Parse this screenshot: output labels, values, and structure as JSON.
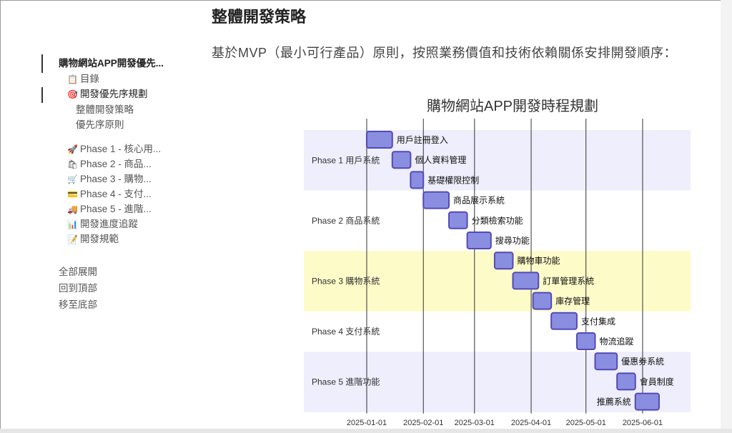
{
  "page": {
    "title": "整體開發策略",
    "intro": "基於MVP（最小可行產品）原則，按照業務價值和技術依賴關係安排開發順序："
  },
  "toc": {
    "title": "購物網站APP開發優先...",
    "items": [
      {
        "icon": "📋",
        "icon_name": "clipboard-icon",
        "label": "目錄"
      },
      {
        "icon": "🎯",
        "icon_name": "target-icon",
        "label": "開發優先序規劃"
      },
      {
        "icon": "🚀",
        "icon_name": "rocket-icon",
        "label": "Phase 1 - 核心用..."
      },
      {
        "icon": "🛍",
        "icon_name": "shopping-bags-icon",
        "label": "Phase 2 - 商品..."
      },
      {
        "icon": "🛒",
        "icon_name": "shopping-cart-icon",
        "label": "Phase 3 - 購物..."
      },
      {
        "icon": "💳",
        "icon_name": "credit-card-icon",
        "label": "Phase 4 - 支付..."
      },
      {
        "icon": "🚚",
        "icon_name": "delivery-truck-icon",
        "label": "Phase 5 - 進階..."
      },
      {
        "icon": "📊",
        "icon_name": "bar-chart-icon",
        "label": "開發進度追蹤"
      },
      {
        "icon": "📝",
        "icon_name": "memo-icon",
        "label": "開發規範"
      }
    ],
    "subitems": [
      "整體開發策略",
      "優先序原則"
    ],
    "controls": [
      "全部展開",
      "回到頂部",
      "移至底部"
    ]
  },
  "chart_data": {
    "type": "gantt",
    "title": "購物網站APP開發時程規劃",
    "x_ticks": [
      "2025-01-01",
      "2025-02-01",
      "2025-03-01",
      "2025-04-01",
      "2025-05-01",
      "2025-06-01"
    ],
    "sections": [
      {
        "name": "Phase 1 用戶系統",
        "color": "#eeeefc",
        "tasks": [
          {
            "name": "用戶註冊登入",
            "start": "2025-01-01",
            "end": "2025-01-15"
          },
          {
            "name": "個人資料管理",
            "start": "2025-01-15",
            "end": "2025-01-25"
          },
          {
            "name": "基礎權限控制",
            "start": "2025-01-25",
            "end": "2025-02-01"
          }
        ]
      },
      {
        "name": "Phase 2 商品系統",
        "color": "#ffffff",
        "tasks": [
          {
            "name": "商品展示系統",
            "start": "2025-02-01",
            "end": "2025-02-15"
          },
          {
            "name": "分類檢索功能",
            "start": "2025-02-15",
            "end": "2025-02-25"
          },
          {
            "name": "搜尋功能",
            "start": "2025-02-25",
            "end": "2025-03-10"
          }
        ]
      },
      {
        "name": "Phase 3 購物系統",
        "color": "#fdfbc8",
        "tasks": [
          {
            "name": "購物車功能",
            "start": "2025-03-12",
            "end": "2025-03-22"
          },
          {
            "name": "訂單管理系統",
            "start": "2025-03-22",
            "end": "2025-04-05"
          },
          {
            "name": "庫存管理",
            "start": "2025-04-02",
            "end": "2025-04-12"
          }
        ]
      },
      {
        "name": "Phase 4 支付系統",
        "color": "#ffffff",
        "tasks": [
          {
            "name": "支付集成",
            "start": "2025-04-12",
            "end": "2025-04-26"
          },
          {
            "name": "物流追蹤",
            "start": "2025-04-26",
            "end": "2025-05-06"
          }
        ]
      },
      {
        "name": "Phase 5 進階功能",
        "color": "#eeeefc",
        "tasks": [
          {
            "name": "優惠券系統",
            "start": "2025-05-06",
            "end": "2025-05-18"
          },
          {
            "name": "會員制度",
            "start": "2025-05-18",
            "end": "2025-05-28"
          },
          {
            "name": "推薦系統",
            "start": "2025-05-28",
            "end": "2025-06-10"
          }
        ]
      }
    ]
  }
}
